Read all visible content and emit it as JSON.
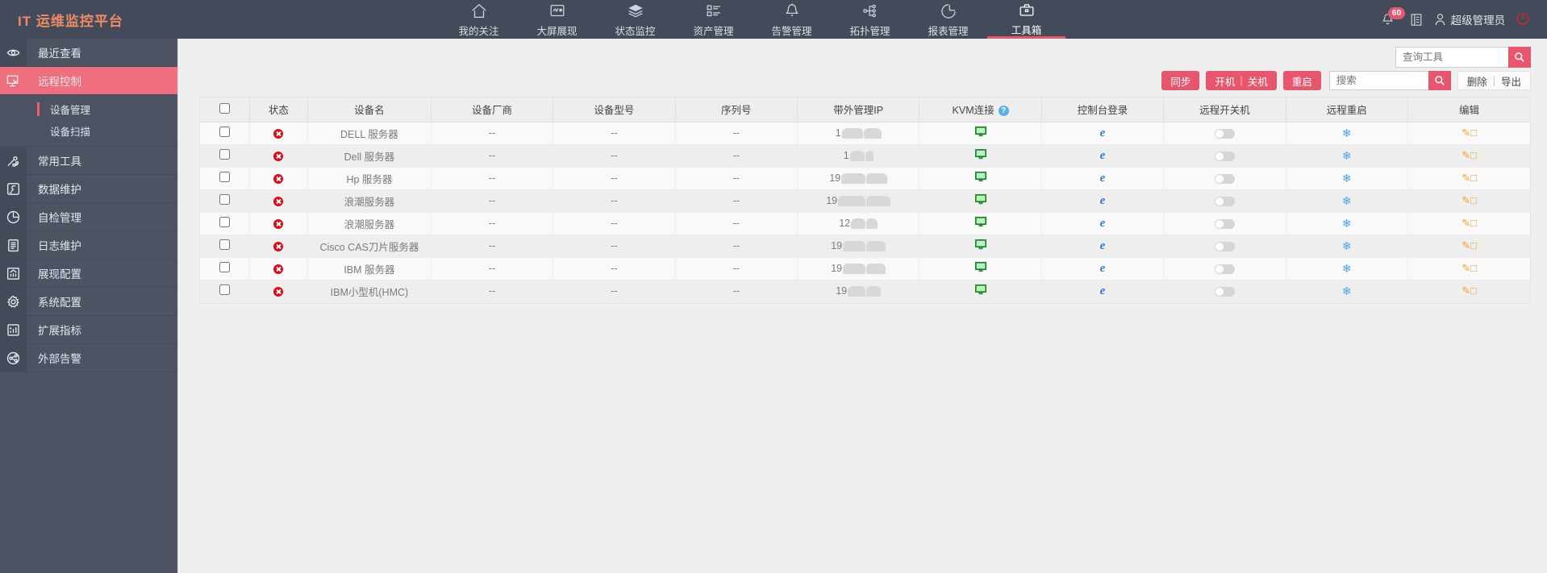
{
  "header": {
    "logo": "IT 运维监控平台",
    "nav": [
      {
        "label": "我的关注",
        "icon": "home-icon",
        "active": false
      },
      {
        "label": "大屏展现",
        "icon": "monitor-icon",
        "active": false
      },
      {
        "label": "状态监控",
        "icon": "layers-icon",
        "active": false
      },
      {
        "label": "资产管理",
        "icon": "list-icon",
        "active": false
      },
      {
        "label": "告警管理",
        "icon": "bell-icon",
        "active": false
      },
      {
        "label": "拓扑管理",
        "icon": "topology-icon",
        "active": false
      },
      {
        "label": "报表管理",
        "icon": "piechart-icon",
        "active": false
      },
      {
        "label": "工具箱",
        "icon": "toolbox-icon",
        "active": true
      }
    ],
    "notification_count": "60",
    "user_name": "超级管理员",
    "accent_color": "#e8566e",
    "logo_color": "#f08a67"
  },
  "sidebar": {
    "items": [
      {
        "label": "最近查看",
        "icon": "eye-icon",
        "active": false
      },
      {
        "label": "远程控制",
        "icon": "remote-desktop-icon",
        "active": true
      },
      {
        "label": "常用工具",
        "icon": "tools-icon",
        "active": false
      },
      {
        "label": "数据维护",
        "icon": "wrench-icon",
        "active": false
      },
      {
        "label": "自检管理",
        "icon": "clock-icon",
        "active": false
      },
      {
        "label": "日志维护",
        "icon": "notepad-icon",
        "active": false
      },
      {
        "label": "展现配置",
        "icon": "chart-icon",
        "active": false
      },
      {
        "label": "系统配置",
        "icon": "gear-icon",
        "active": false
      },
      {
        "label": "扩展指标",
        "icon": "bar-plus-icon",
        "active": false
      },
      {
        "label": "外部告警",
        "icon": "share-icon",
        "active": false
      }
    ],
    "sub_items": [
      {
        "label": "设备管理",
        "selected": true
      },
      {
        "label": "设备扫描",
        "selected": false
      }
    ]
  },
  "main": {
    "query_search": {
      "placeholder": "查询工具",
      "value": ""
    },
    "toolbar": {
      "sync_label": "同步",
      "power_on_label": "开机",
      "power_off_label": "关机",
      "restart_label": "重启",
      "search_placeholder": "搜索",
      "search_value": "",
      "delete_label": "删除",
      "export_label": "导出",
      "separator": "|"
    },
    "table": {
      "columns": [
        "状态",
        "设备名",
        "设备厂商",
        "设备型号",
        "序列号",
        "带外管理IP",
        "KVM连接",
        "控制台登录",
        "远程开关机",
        "远程重启",
        "编辑"
      ],
      "kvm_help": "?",
      "rows": [
        {
          "status": "error",
          "name": "DELL 服务器",
          "vendor": "--",
          "model": "--",
          "serial": "--",
          "ip_prefix": "1",
          "ip_mask": "blurred"
        },
        {
          "status": "error",
          "name": "Dell 服务器",
          "vendor": "--",
          "model": "--",
          "serial": "--",
          "ip_prefix": "1",
          "ip_mask": "blurred"
        },
        {
          "status": "error",
          "name": "Hp 服务器",
          "vendor": "--",
          "model": "--",
          "serial": "--",
          "ip_prefix": "19",
          "ip_mask": "blurred"
        },
        {
          "status": "error",
          "name": "浪潮服务器",
          "vendor": "--",
          "model": "--",
          "serial": "--",
          "ip_prefix": "19",
          "ip_mask": "blurred"
        },
        {
          "status": "error",
          "name": "浪潮服务器",
          "vendor": "--",
          "model": "--",
          "serial": "--",
          "ip_prefix": "12",
          "ip_mask": "blurred"
        },
        {
          "status": "error",
          "name": "Cisco CAS刀片服务器",
          "vendor": "--",
          "model": "--",
          "serial": "--",
          "ip_prefix": "19",
          "ip_mask": "blurred"
        },
        {
          "status": "error",
          "name": "IBM 服务器",
          "vendor": "--",
          "model": "--",
          "serial": "--",
          "ip_prefix": "19",
          "ip_mask": "blurred"
        },
        {
          "status": "error",
          "name": "IBM小型机(HMC)",
          "vendor": "--",
          "model": "--",
          "serial": "--",
          "ip_prefix": "19",
          "ip_mask": "blurred"
        }
      ]
    }
  }
}
